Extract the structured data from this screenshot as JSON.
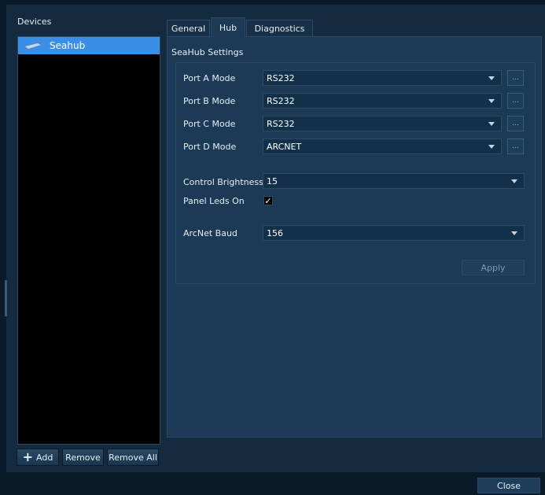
{
  "sidebar": {
    "title": "Devices",
    "devices": [
      {
        "label": "Seahub",
        "icon": "seahub-device-icon"
      }
    ],
    "buttons": {
      "add": "Add",
      "remove": "Remove",
      "remove_all": "Remove All"
    }
  },
  "tabs": [
    {
      "label": "General"
    },
    {
      "label": "Hub",
      "active": true
    },
    {
      "label": "Diagnostics"
    }
  ],
  "hub": {
    "group_title": "SeaHub Settings",
    "ports": [
      {
        "label": "Port A Mode",
        "value": "RS232"
      },
      {
        "label": "Port B Mode",
        "value": "RS232"
      },
      {
        "label": "Port C Mode",
        "value": "RS232"
      },
      {
        "label": "Port D Mode",
        "value": "ARCNET"
      }
    ],
    "control_brightness": {
      "label": "Control Brightness",
      "value": "15"
    },
    "panel_leds": {
      "label": "Panel Leds On",
      "checked": true
    },
    "arcnet_baud": {
      "label": "ArcNet Baud",
      "value": "156"
    },
    "apply_label": "Apply",
    "more_label": "..."
  },
  "footer": {
    "close_label": "Close"
  },
  "colors": {
    "selection": "#3b8ee6",
    "panel": "#1c3a55",
    "background": "#132a3f"
  }
}
